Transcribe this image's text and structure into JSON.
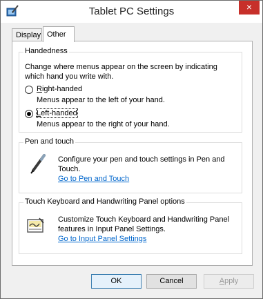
{
  "window": {
    "title": "Tablet PC Settings",
    "close_glyph": "×"
  },
  "tabs": [
    {
      "label": "Display"
    },
    {
      "label": "Other"
    }
  ],
  "handedness": {
    "title": "Handedness",
    "description": "Change where menus appear on the screen by indicating which hand you write with.",
    "right": {
      "accel": "R",
      "rest": "ight-handed",
      "desc": "Menus appear to the left of your hand.",
      "selected": false
    },
    "left": {
      "accel": "L",
      "rest": "eft-handed",
      "desc": "Menus appear to the right of your hand.",
      "selected": true
    }
  },
  "pen_touch": {
    "title": "Pen and touch",
    "description": "Configure your pen and touch settings in Pen and Touch.",
    "link": "Go to Pen and Touch",
    "icon": "pen-icon"
  },
  "keyboard_panel": {
    "title": "Touch Keyboard and Handwriting Panel options",
    "description": "Customize Touch Keyboard and Handwriting Panel features in Input Panel Settings.",
    "link": "Go to Input Panel Settings",
    "icon": "input-panel-icon"
  },
  "buttons": {
    "ok": "OK",
    "cancel": "Cancel",
    "apply_accel": "A",
    "apply_rest": "pply"
  },
  "colors": {
    "close_button": "#c7302a",
    "link": "#0066cc"
  }
}
